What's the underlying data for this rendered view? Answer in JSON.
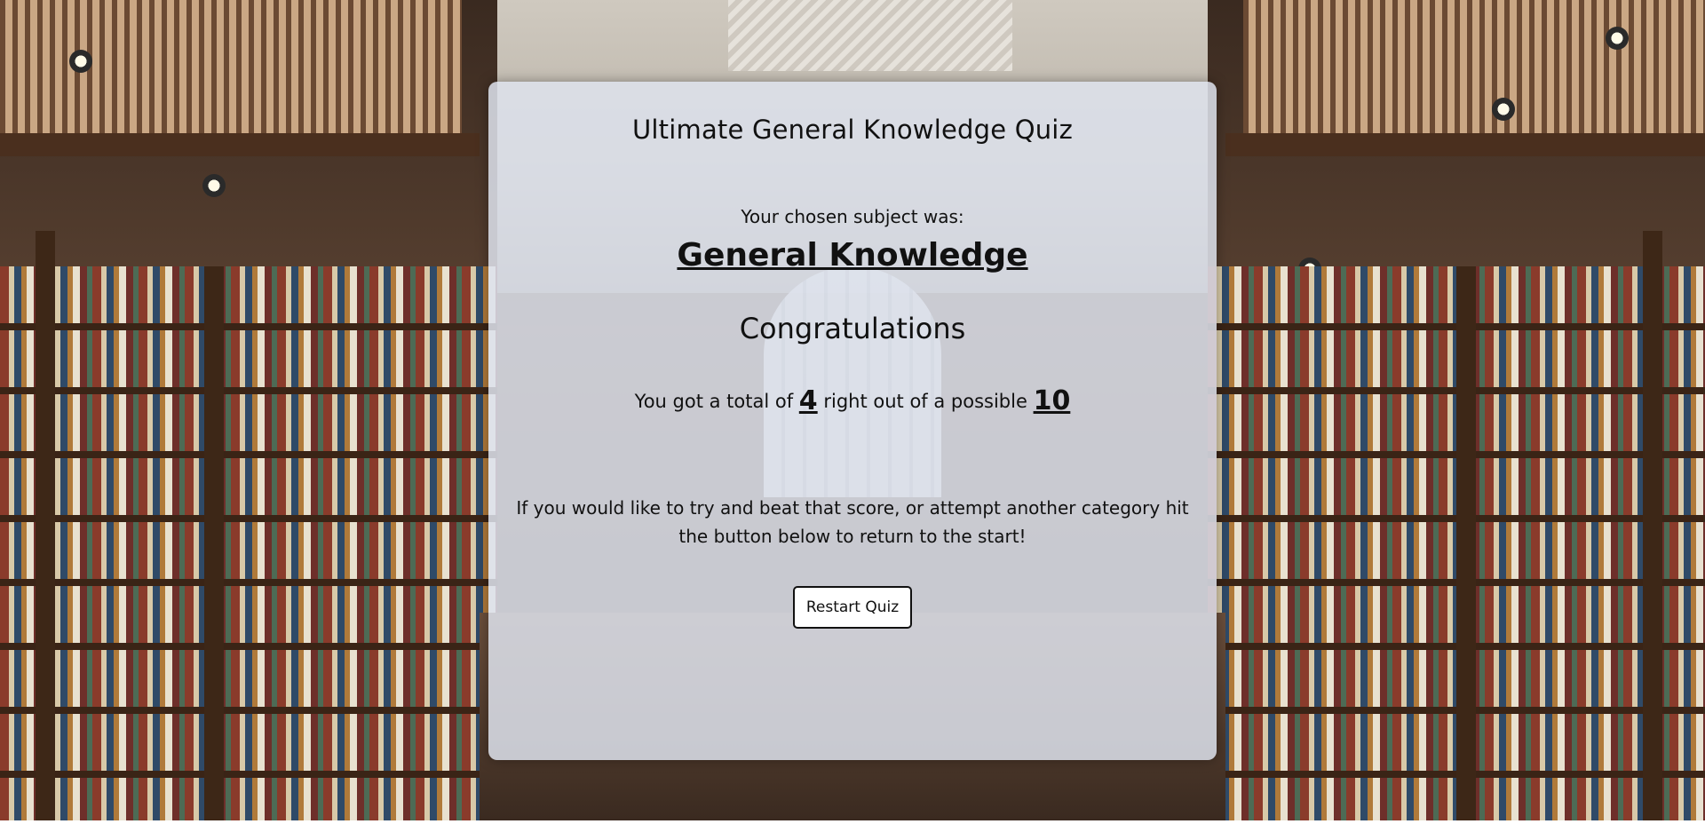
{
  "quiz": {
    "title": "Ultimate General Knowledge Quiz",
    "subject_label": "Your chosen subject was:",
    "subject_name": "General Knowledge",
    "congrats": "Congratulations",
    "score_prefix": "You got a total of",
    "score": "4",
    "score_middle": "right out of a possible",
    "total": "10",
    "message": "If you would like to try and beat that score, or attempt another category hit the button below to return to the start!",
    "restart_label": "Restart Quiz"
  }
}
